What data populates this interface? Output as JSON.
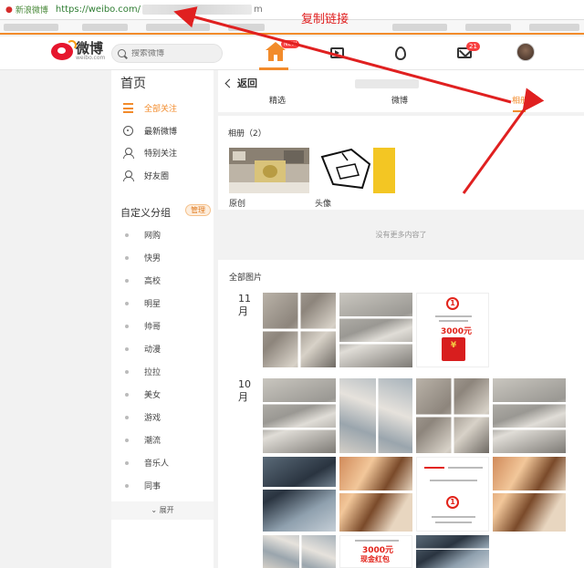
{
  "browser": {
    "site_name": "新浪微博",
    "url_prefix": "https://weibo.com/",
    "url_suffix": "m"
  },
  "annotation": {
    "text": "复制链接",
    "color": "#e02020"
  },
  "nav": {
    "logo_text": "微博",
    "logo_sub": "weibo.com",
    "search_placeholder": "搜索微博",
    "home_badge": "NEW",
    "mail_badge": "21",
    "accent": "#f28b2b",
    "badge_color": "#f73e3e"
  },
  "sidebar": {
    "title": "首页",
    "items": [
      {
        "label": "全部关注",
        "icon": "list-icon",
        "active": true
      },
      {
        "label": "最新微博",
        "icon": "clock-icon",
        "active": false
      },
      {
        "label": "特别关注",
        "icon": "user-star-icon",
        "active": false
      },
      {
        "label": "好友圈",
        "icon": "user-group-icon",
        "active": false
      }
    ],
    "group_title": "自定义分组",
    "manage_label": "管理",
    "groups": [
      "网购",
      "快男",
      "高校",
      "明星",
      "帅哥",
      "动漫",
      "拉拉",
      "美女",
      "游戏",
      "潮流",
      "音乐人",
      "同事"
    ],
    "expand_label": "展开"
  },
  "main": {
    "back_label": "返回",
    "tabs": [
      {
        "label": "精选",
        "active": false
      },
      {
        "label": "微博",
        "active": false
      },
      {
        "label": "相册",
        "active": true
      }
    ],
    "albums_title": "相册（2）",
    "albums": [
      {
        "caption": "原创"
      },
      {
        "caption": "头像"
      }
    ],
    "no_more": "没有更多内容了",
    "all_photos_title": "全部图片",
    "months": [
      {
        "label": "11月"
      },
      {
        "label": "10月"
      }
    ],
    "ad": {
      "number": "1",
      "amount": "3000元",
      "red_packet_text": "现金红包"
    }
  }
}
